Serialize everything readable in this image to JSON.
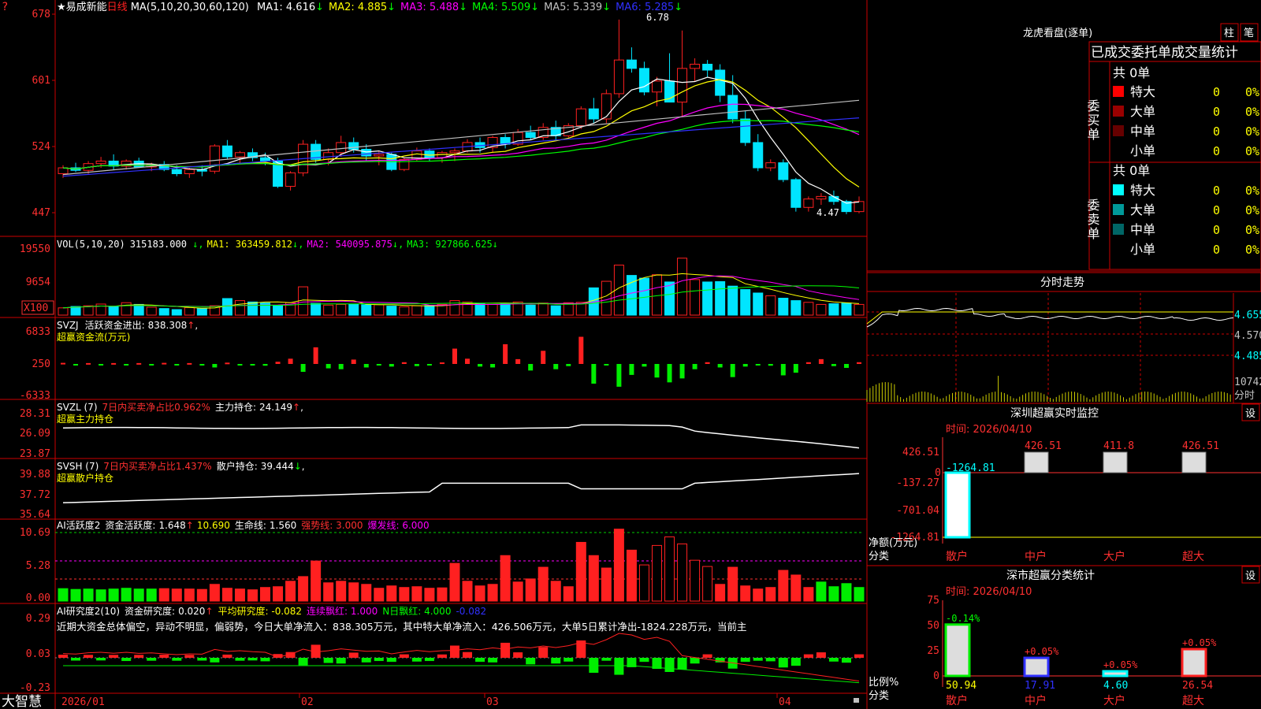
{
  "stock": {
    "name": "易成新能",
    "period": "日线",
    "star": "★",
    "top_marker": "?"
  },
  "colors": {
    "up": "#ff2020",
    "down": "#00e5ff",
    "ma1": "#ffffff",
    "ma2": "#ffff00",
    "ma3": "#ff00ff",
    "ma4": "#00ff00",
    "ma5": "#c0c0c0",
    "ma6": "#3030ff",
    "frame": "#cc0000",
    "axis_text": "#ff3030"
  },
  "main_panel": {
    "header_prefix": "MA(5,10,20,30,60,120)",
    "ma": [
      {
        "label": "MA1:",
        "value": "4.616",
        "arrow": "↓",
        "color": "#ffffff"
      },
      {
        "label": "MA2:",
        "value": "4.885",
        "arrow": "↓",
        "color": "#ffff00"
      },
      {
        "label": "MA3:",
        "value": "5.488",
        "arrow": "↓",
        "color": "#ff00ff"
      },
      {
        "label": "MA4:",
        "value": "5.509",
        "arrow": "↓",
        "color": "#00ff00"
      },
      {
        "label": "MA5:",
        "value": "5.339",
        "arrow": "↓",
        "color": "#c0c0c0"
      },
      {
        "label": "MA6:",
        "value": "5.285",
        "arrow": "↓",
        "color": "#3030ff"
      }
    ],
    "y_labels": [
      "678",
      "601",
      "524",
      "447"
    ],
    "high_label": "6.78",
    "low_label": "4.47"
  },
  "vol_panel": {
    "header": "VOL(5,10,20)",
    "value": "315183.000",
    "ma": [
      {
        "label": "MA1:",
        "value": "363459.812",
        "arrow": "↓",
        "color": "#ffff00"
      },
      {
        "label": "MA2:",
        "value": "540095.875",
        "arrow": "↓",
        "color": "#ff00ff"
      },
      {
        "label": "MA3:",
        "value": "927866.625",
        "arrow": "↓",
        "color": "#00ff00"
      }
    ],
    "y_labels": [
      "19550",
      "9654"
    ],
    "unit": "X100"
  },
  "svzj_panel": {
    "title": "SVZJ",
    "label": "活跃资金进出:",
    "value": "838.308",
    "arrow": "↑",
    "comma": ",",
    "subtitle": "超赢资金流(万元)",
    "y_labels": [
      "6833",
      "250",
      "-6333"
    ]
  },
  "svzl_panel": {
    "title": "SVZL (7)",
    "text1": "7日内买卖净占比0.962%",
    "label": "主力持仓:",
    "value": "24.149",
    "arrow": "↑",
    "comma": ",",
    "subtitle": "超赢主力持仓",
    "y_labels": [
      "28.31",
      "26.09",
      "23.87"
    ]
  },
  "svsh_panel": {
    "title": "SVSH (7)",
    "text1": "7日内买卖净占比1.437%",
    "label": "散户持仓:",
    "value": "39.444",
    "arrow": "↓",
    "comma": ",",
    "subtitle": "超赢散户持仓",
    "y_labels": [
      "39.88",
      "37.72",
      "35.64"
    ]
  },
  "ai_active_panel": {
    "title": "AI活跃度2",
    "label": "资金活跃度:",
    "value": "1.648",
    "v2": "10.690",
    "life_label": "生命线:",
    "life_value": "1.560",
    "strong": "强势线: 3.000",
    "burst": "爆发线: 6.000",
    "y_labels": [
      "10.69",
      "5.28",
      "0.00"
    ]
  },
  "ai_research_panel": {
    "title": "AI研究度2(10)",
    "label": "资金研究度:",
    "value": "0.020",
    "avg": "平均研究度: -0.082",
    "consec": "连续飘红: 1.000",
    "ndays": "N日飘红: 4.000",
    "last": "-0.082",
    "summary": "近期大资金总体偏空，异动不明显，偏弱势，今日大单净流入：838.305万元，其中特大单净流入：426.506万元，大单5日累计净出-1824.228万元，当前主",
    "y_labels": [
      "0.29",
      "0.03",
      "-0.23"
    ]
  },
  "x_axis": {
    "labels": [
      "2026/01",
      "02",
      "03",
      "04"
    ]
  },
  "brand": "大智慧",
  "right": {
    "dragon_title": "龙虎看盘(逐单)",
    "tab_bar": "柱",
    "tab_detail": "笔",
    "stats_header": "已成交委托单成交量统计",
    "buy_label": "委买单",
    "sell_label": "委卖单",
    "buy_total": "共 0单",
    "sell_total": "共 0单",
    "buy_rows": [
      {
        "name": "特大",
        "count": "0",
        "pct": "0%",
        "color": "#ff0000"
      },
      {
        "name": "大单",
        "count": "0",
        "pct": "0%",
        "color": "#990000"
      },
      {
        "name": "中单",
        "count": "0",
        "pct": "0%",
        "color": "#660000"
      },
      {
        "name": "小单",
        "count": "0",
        "pct": "0%",
        "color": "#000000"
      }
    ],
    "sell_rows": [
      {
        "name": "特大",
        "count": "0",
        "pct": "0%",
        "color": "#00ffff"
      },
      {
        "name": "大单",
        "count": "0",
        "pct": "0%",
        "color": "#009999"
      },
      {
        "name": "中单",
        "count": "0",
        "pct": "0%",
        "color": "#006666"
      },
      {
        "name": "小单",
        "count": "0",
        "pct": "0%",
        "color": "#000000"
      }
    ],
    "intraday_title": "分时走势",
    "intraday_labels": [
      "4.655",
      "4.570",
      "4.485"
    ],
    "intraday_vol": "10742",
    "intraday_vol_unit": "分时",
    "monitor_title": "深圳超赢实时监控",
    "set_label": "设",
    "time_label": "时间: 2026/04/10",
    "monitor_y_labels": [
      "426.51",
      "-137.27",
      "-701.04",
      "-1264.81"
    ],
    "monitor_zero": "0",
    "monitor_y_title": "净额(万元)",
    "monitor_x_title": "分类",
    "categories": [
      "散户",
      "中户",
      "大户",
      "超大"
    ],
    "monitor_values_text": [
      "-1264.81",
      "426.51",
      "411.8",
      "426.51"
    ],
    "class_title": "深市超赢分类统计",
    "class_y_labels": [
      "75",
      "50",
      "25",
      "0"
    ],
    "class_y_title": "比例%",
    "class_x_title": "分类",
    "class_values_text": [
      "-0.14%",
      "+0.05%",
      "+0.05%",
      "+0.05%"
    ],
    "class_bottom_text": [
      "50.94",
      "17.91",
      "4.60",
      "26.54"
    ]
  },
  "chart_data": [
    {
      "type": "candlestick",
      "title": "易成新能 日线",
      "ylim": [
        4.3,
        6.9
      ],
      "x_labels": [
        "2026/01",
        "02",
        "03",
        "04"
      ],
      "candles": [
        [
          4.95,
          5.05,
          4.9,
          5.02
        ],
        [
          5.02,
          5.08,
          4.97,
          4.99
        ],
        [
          4.99,
          5.1,
          4.95,
          5.07
        ],
        [
          5.07,
          5.15,
          5.02,
          5.1
        ],
        [
          5.1,
          5.18,
          5.0,
          5.04
        ],
        [
          5.04,
          5.12,
          5.0,
          5.1
        ],
        [
          5.1,
          5.14,
          5.02,
          5.03
        ],
        [
          5.03,
          5.08,
          4.98,
          5.06
        ],
        [
          5.06,
          5.1,
          4.98,
          5.0
        ],
        [
          5.0,
          5.05,
          4.92,
          4.95
        ],
        [
          4.95,
          5.02,
          4.9,
          5.0
        ],
        [
          5.0,
          5.05,
          4.92,
          4.98
        ],
        [
          4.98,
          5.3,
          4.95,
          5.28
        ],
        [
          5.28,
          5.35,
          5.12,
          5.15
        ],
        [
          5.15,
          5.22,
          5.08,
          5.2
        ],
        [
          5.2,
          5.25,
          5.1,
          5.14
        ],
        [
          5.14,
          5.2,
          5.05,
          5.1
        ],
        [
          5.1,
          5.14,
          4.78,
          4.8
        ],
        [
          4.8,
          4.98,
          4.75,
          4.96
        ],
        [
          4.96,
          5.35,
          4.92,
          5.3
        ],
        [
          5.3,
          5.35,
          5.08,
          5.12
        ],
        [
          5.12,
          5.25,
          5.05,
          5.2
        ],
        [
          5.2,
          5.4,
          5.15,
          5.32
        ],
        [
          5.32,
          5.38,
          5.2,
          5.24
        ],
        [
          5.24,
          5.3,
          5.1,
          5.16
        ],
        [
          5.16,
          5.22,
          5.05,
          5.18
        ],
        [
          5.18,
          5.2,
          4.98,
          5.0
        ],
        [
          5.0,
          5.14,
          4.98,
          5.12
        ],
        [
          5.12,
          5.26,
          5.1,
          5.22
        ],
        [
          5.22,
          5.25,
          5.1,
          5.14
        ],
        [
          5.14,
          5.22,
          5.08,
          5.2
        ],
        [
          5.2,
          5.25,
          5.1,
          5.22
        ],
        [
          5.22,
          5.36,
          5.2,
          5.32
        ],
        [
          5.32,
          5.38,
          5.2,
          5.26
        ],
        [
          5.26,
          5.4,
          5.2,
          5.38
        ],
        [
          5.38,
          5.42,
          5.25,
          5.3
        ],
        [
          5.3,
          5.48,
          5.28,
          5.44
        ],
        [
          5.44,
          5.52,
          5.35,
          5.38
        ],
        [
          5.38,
          5.55,
          5.35,
          5.5
        ],
        [
          5.5,
          5.58,
          5.35,
          5.4
        ],
        [
          5.4,
          5.55,
          5.38,
          5.52
        ],
        [
          5.52,
          5.75,
          5.48,
          5.72
        ],
        [
          5.72,
          5.85,
          5.55,
          5.6
        ],
        [
          5.6,
          5.95,
          5.55,
          5.9
        ],
        [
          5.9,
          6.78,
          5.85,
          6.3
        ],
        [
          6.3,
          6.45,
          6.15,
          6.2
        ],
        [
          6.2,
          6.28,
          5.88,
          5.92
        ],
        [
          5.92,
          6.1,
          5.75,
          6.05
        ],
        [
          6.05,
          6.38,
          5.8,
          5.8
        ],
        [
          5.8,
          6.65,
          5.62,
          6.2
        ],
        [
          6.2,
          6.32,
          6.05,
          6.25
        ],
        [
          6.25,
          6.3,
          6.1,
          6.18
        ],
        [
          6.18,
          6.25,
          5.8,
          5.88
        ],
        [
          5.88,
          6.12,
          5.55,
          5.6
        ],
        [
          5.6,
          5.7,
          5.28,
          5.32
        ],
        [
          5.32,
          5.42,
          4.98,
          5.02
        ],
        [
          5.02,
          5.12,
          4.98,
          5.08
        ],
        [
          5.08,
          5.12,
          4.85,
          4.88
        ],
        [
          4.88,
          4.9,
          4.5,
          4.55
        ],
        [
          4.55,
          4.68,
          4.5,
          4.65
        ],
        [
          4.65,
          4.72,
          4.58,
          4.68
        ],
        [
          4.68,
          4.75,
          4.58,
          4.62
        ],
        [
          4.62,
          4.64,
          4.47,
          4.5
        ],
        [
          4.5,
          4.68,
          4.48,
          4.62
        ]
      ]
    },
    {
      "type": "bar",
      "title": "VOL(5,10,20)",
      "ylim": [
        0,
        21000
      ],
      "values": [
        2100,
        2500,
        2700,
        3200,
        2400,
        3600,
        3100,
        2300,
        1900,
        1600,
        2200,
        2000,
        2700,
        4800,
        4200,
        3800,
        3500,
        2800,
        3600,
        8200,
        3400,
        2900,
        3100,
        3200,
        3000,
        3000,
        2600,
        2400,
        2700,
        2800,
        3100,
        4200,
        3800,
        3200,
        3100,
        3300,
        3800,
        2900,
        3500,
        2700,
        3600,
        3700,
        7900,
        9800,
        14500,
        11500,
        10700,
        11700,
        9600,
        16500,
        10300,
        9600,
        9700,
        8400,
        7400,
        6400,
        5600,
        4900,
        4200,
        3700,
        3100,
        3300,
        3500,
        3100
      ]
    },
    {
      "type": "bar",
      "title": "超赢资金流(万元)",
      "ylim": [
        -6333,
        6833
      ],
      "values": [
        250,
        -150,
        200,
        -100,
        200,
        -300,
        200,
        -200,
        250,
        -200,
        200,
        -150,
        -800,
        300,
        -200,
        -100,
        -400,
        500,
        1200,
        -1800,
        3800,
        -1000,
        -1200,
        1000,
        -800,
        -300,
        -600,
        400,
        -500,
        -300,
        350,
        3500,
        1200,
        -600,
        -800,
        4500,
        1100,
        -1500,
        3000,
        -1200,
        -500,
        6200,
        -4500,
        -200,
        -5200,
        -2500,
        -600,
        -3100,
        -4200,
        -3300,
        -1200,
        400,
        -800,
        -3000,
        -600,
        -200,
        -400,
        -2600,
        -2000,
        400,
        1100,
        -500,
        -900,
        400
      ]
    }
  ]
}
